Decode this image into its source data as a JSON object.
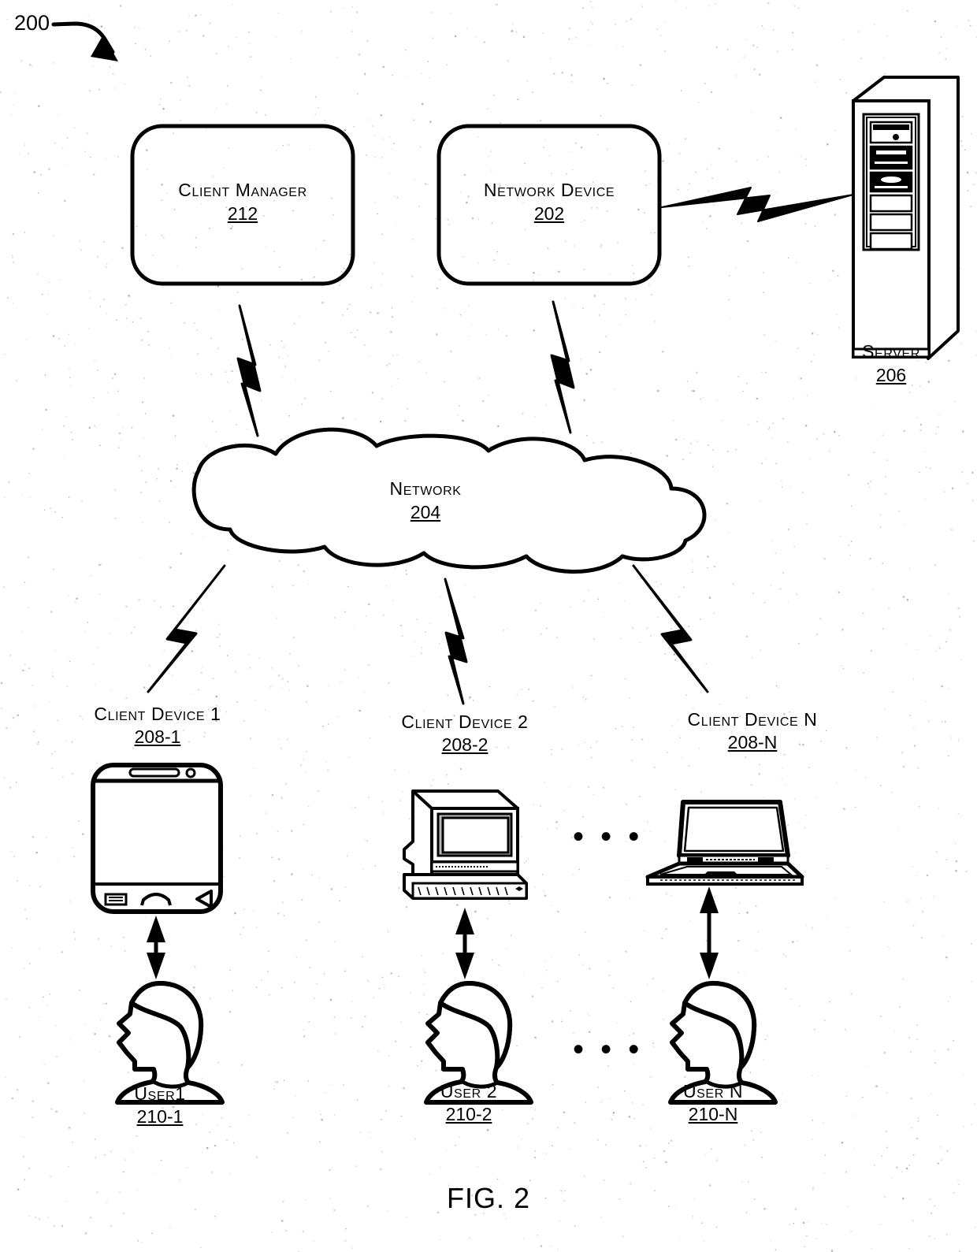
{
  "figure": {
    "tag": "200",
    "caption": "FIG. 2"
  },
  "nodes": {
    "client_manager": {
      "label": "Client Manager",
      "ref": "212"
    },
    "network_device": {
      "label": "Network Device",
      "ref": "202"
    },
    "server": {
      "label": "Server",
      "ref": "206"
    },
    "network_cloud": {
      "label": "Network",
      "ref": "204"
    }
  },
  "client_devices": [
    {
      "label": "Client Device 1",
      "ref": "208-1",
      "icon": "smartphone-icon"
    },
    {
      "label": "Client Device 2",
      "ref": "208-2",
      "icon": "desktop-computer-icon"
    },
    {
      "label": "Client Device N",
      "ref": "208-N",
      "icon": "laptop-icon"
    }
  ],
  "users": [
    {
      "label": "User1",
      "ref": "210-1",
      "icon": "user-head-icon"
    },
    {
      "label": "User 2",
      "ref": "210-2",
      "icon": "user-head-icon"
    },
    {
      "label": "User N",
      "ref": "210-N",
      "icon": "user-head-icon"
    }
  ],
  "ellipses": {
    "devices_row": "• • •",
    "users_row": "• • •"
  },
  "colors": {
    "ink": "#000000",
    "paper": "#ffffff"
  }
}
